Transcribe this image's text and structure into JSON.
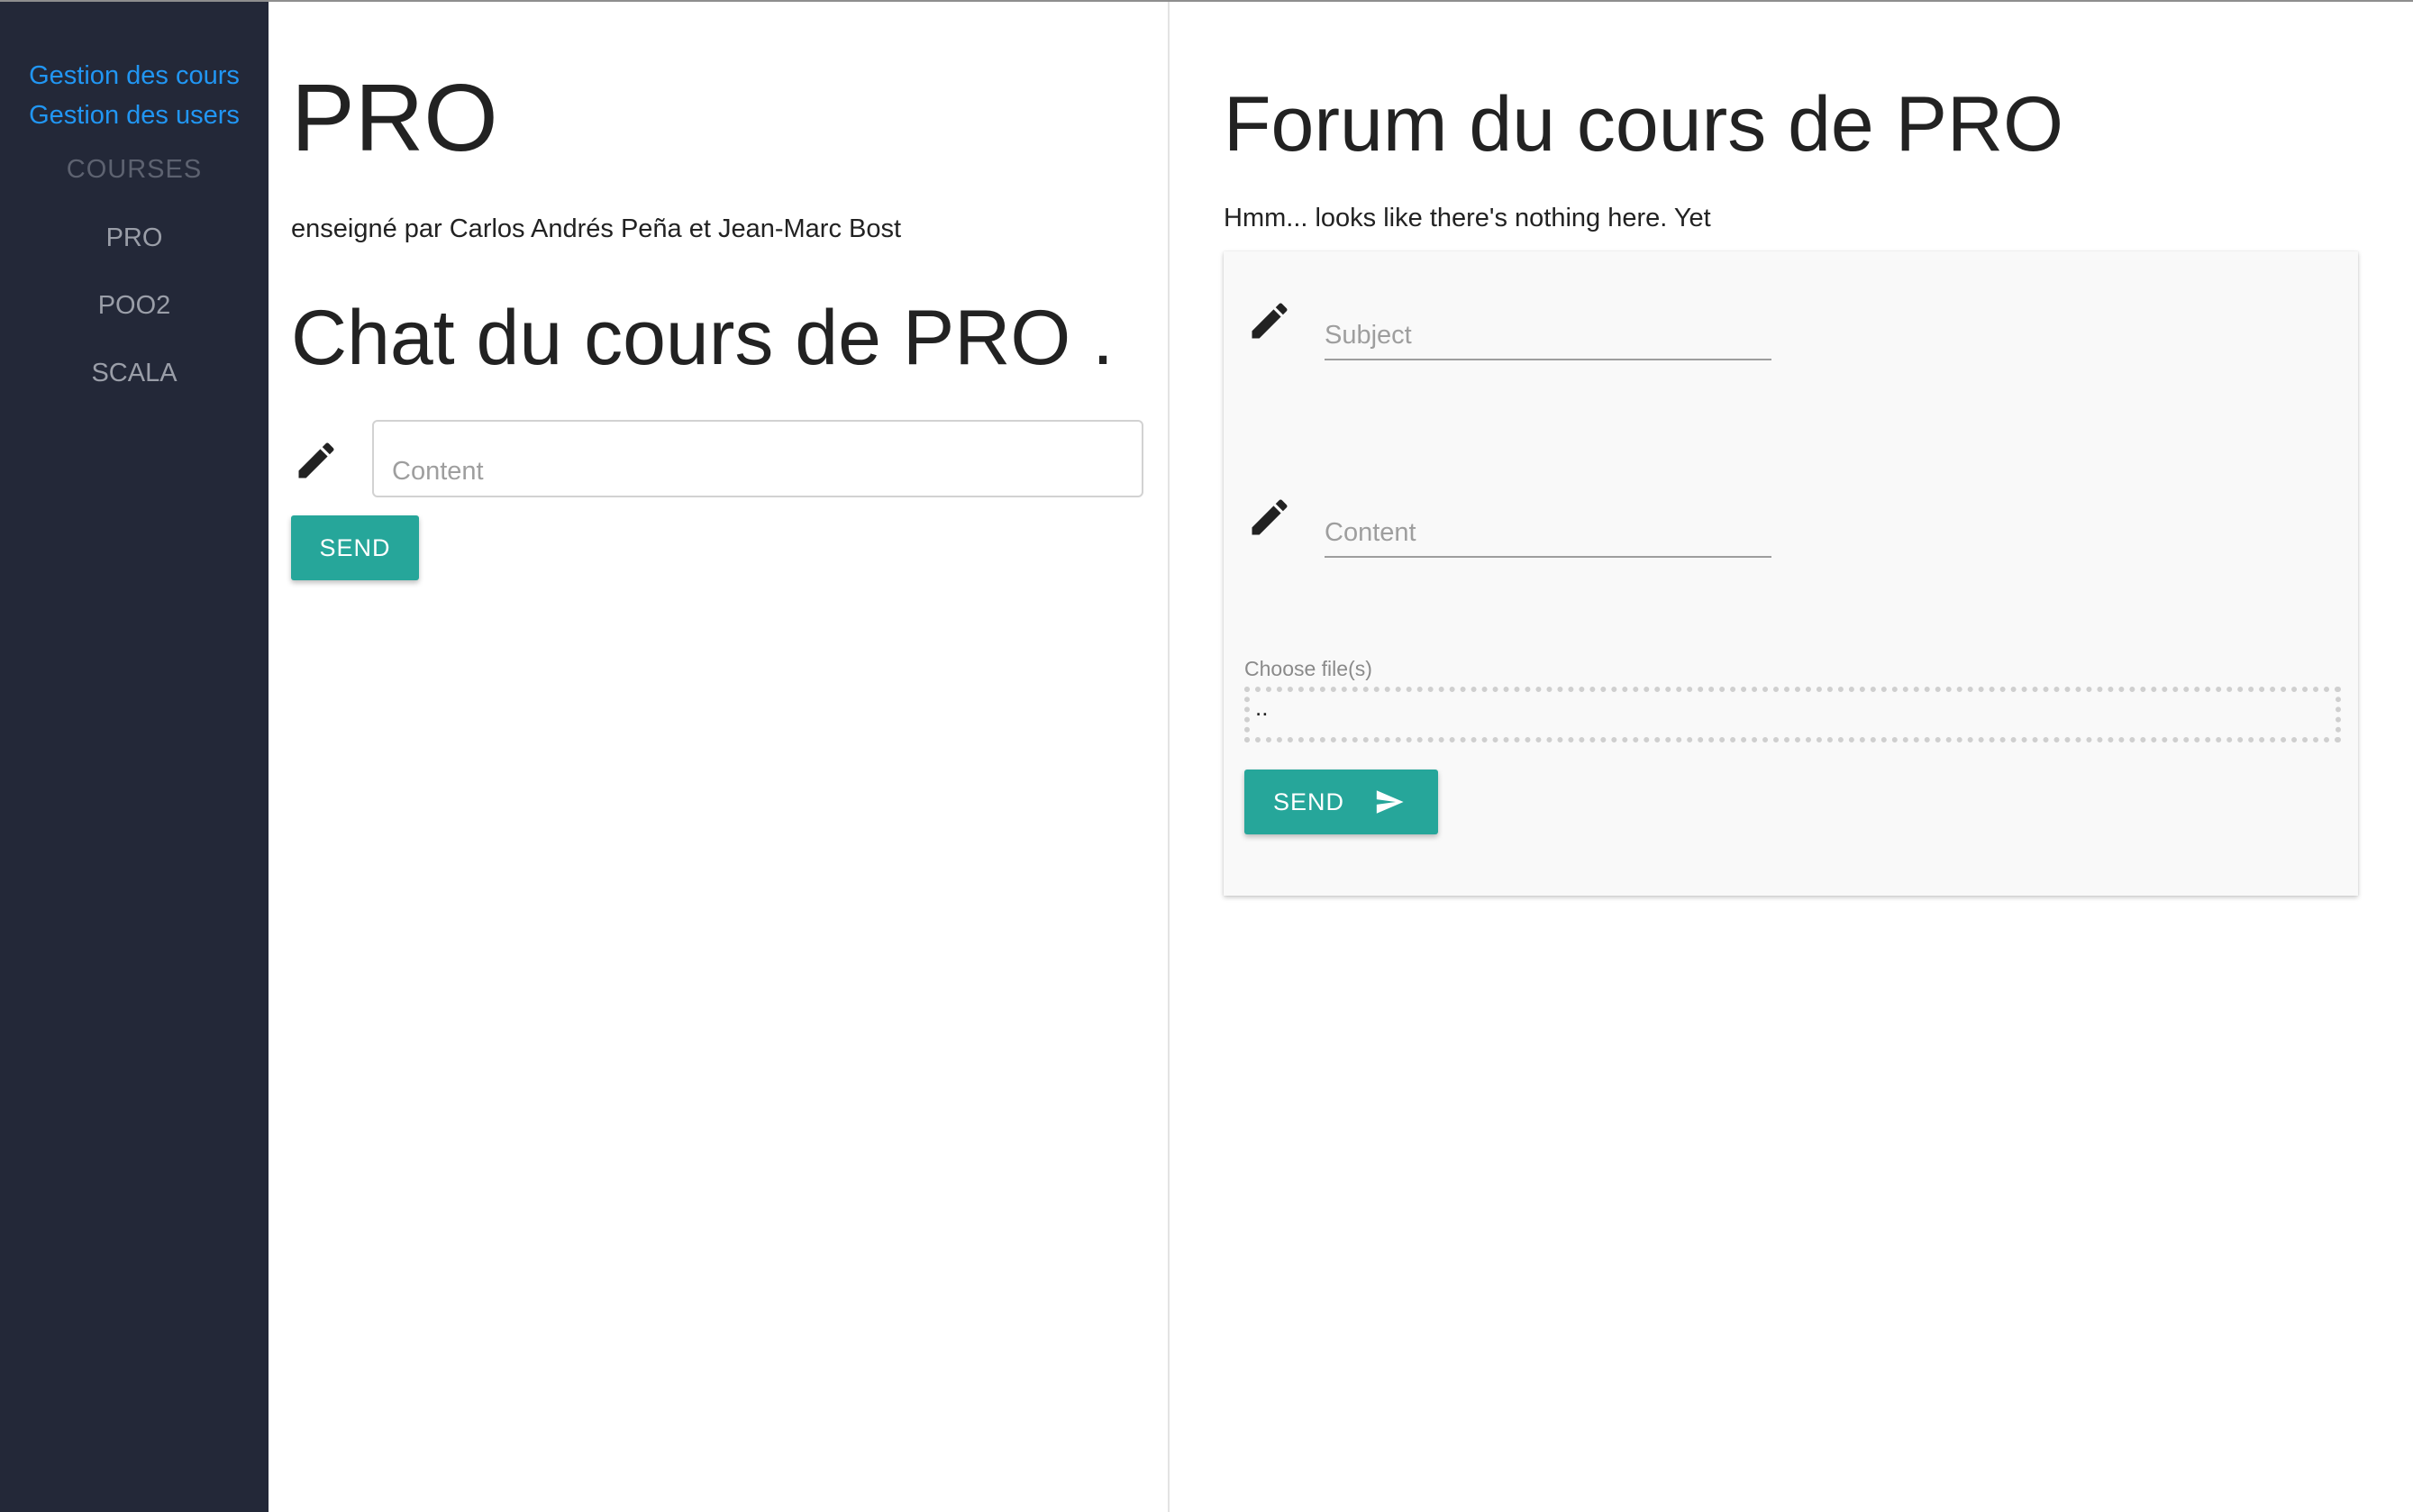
{
  "sidebar": {
    "admin_links": [
      "Gestion des cours",
      "Gestion des users"
    ],
    "heading": "COURSES",
    "courses": [
      "PRO",
      "POO2",
      "SCALA"
    ]
  },
  "course": {
    "title": "PRO",
    "teachers": "enseigné par Carlos Andrés Peña et Jean-Marc Bost"
  },
  "chat": {
    "title": "Chat du cours de PRO .",
    "content_placeholder": "Content",
    "send_label": "SEND"
  },
  "forum": {
    "title": "Forum du cours de PRO",
    "empty_message": "Hmm... looks like there's nothing here. Yet",
    "subject_placeholder": "Subject",
    "content_placeholder": "Content",
    "file_label": "Choose file(s)",
    "file_value": "..",
    "send_label": "SEND"
  },
  "colors": {
    "sidebar_bg": "#232838",
    "link": "#2196f3",
    "accent": "#26a69a"
  },
  "icons": {
    "chat_field": "pencil-icon",
    "subject_field": "pencil-icon",
    "content_field": "pencil-icon",
    "forum_send": "send-arrow-icon"
  }
}
